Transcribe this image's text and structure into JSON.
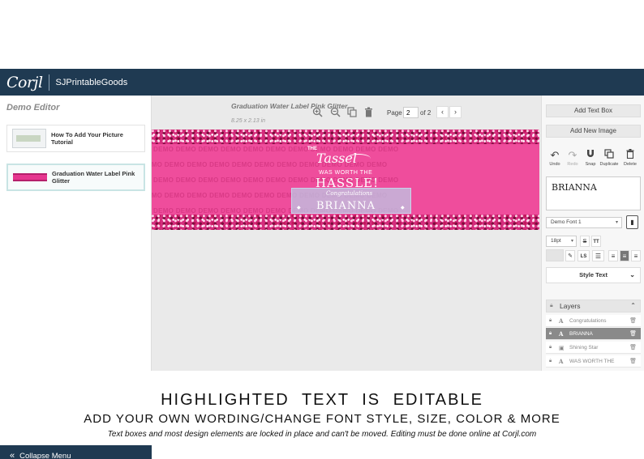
{
  "app": {
    "logo": "Corjl",
    "shop_name": "SJPrintableGoods"
  },
  "left_panel": {
    "title": "Demo Editor",
    "projects": [
      {
        "label": "How To Add Your Picture Tutorial",
        "active": false
      },
      {
        "label": "Graduation Water Label Pink Glitter",
        "active": true
      }
    ],
    "collapse_icon": "double-chevron-left-icon",
    "collapse_label": "Collapse Menu"
  },
  "canvas": {
    "project_title": "Graduation Water Label Pink Glitter",
    "project_size": "8.25 x 2.13 in",
    "toolbar_icons": [
      "zoom-in-icon",
      "zoom-out-icon",
      "copy-icon",
      "trash-icon"
    ],
    "page_label": "Page",
    "page_value": "2",
    "page_total": "of 2",
    "prev_symbol": "‹",
    "next_symbol": "›"
  },
  "label_design": {
    "watermark": "DEMO",
    "the": "THE",
    "tassel": "Tassel",
    "worth": "WAS WORTH THE",
    "hassle": "HASSLE!",
    "congrats": "Congratulations",
    "name": "BRIANNA",
    "colors": {
      "background": "#ef4d9c",
      "glitter": "#d42c7c",
      "selection": "#bec8e6"
    }
  },
  "right_panel": {
    "add_text": "Add Text Box",
    "add_image": "Add New Image",
    "tools": [
      {
        "icon": "undo-icon",
        "label": "Undo",
        "enabled": true
      },
      {
        "icon": "redo-icon",
        "label": "Redo",
        "enabled": false
      },
      {
        "icon": "magnet-icon",
        "label": "Snap",
        "enabled": true
      },
      {
        "icon": "duplicate-icon",
        "label": "Duplicate",
        "enabled": true
      },
      {
        "icon": "trash-icon",
        "label": "Delete",
        "enabled": true
      }
    ],
    "text_value": "BRIANNA",
    "font": "Demo Font 1",
    "font_size": "18pt",
    "format": {
      "strike": "S",
      "caps": "TT",
      "letter_spacing": "LS"
    },
    "style_text": "Style Text",
    "layers_title": "Layers",
    "layers": [
      {
        "type": "A",
        "name": "Congratulations",
        "selected": false,
        "icon": "text-icon"
      },
      {
        "type": "A",
        "name": "BRIANNA",
        "selected": true,
        "icon": "text-icon"
      },
      {
        "type": "▣",
        "name": "Shining Star",
        "selected": false,
        "icon": "image-icon"
      },
      {
        "type": "A",
        "name": "WAS WORTH THE",
        "selected": false,
        "icon": "text-icon"
      }
    ]
  },
  "captions": {
    "headline": "HIGHLIGHTED TEXT IS EDITABLE",
    "subline": "ADD YOUR OWN WORDING/CHANGE FONT STYLE, SIZE, COLOR & MORE",
    "note": "Text boxes and most design elements are locked in place and can't be moved. Editing must be done online at Corjl.com"
  }
}
